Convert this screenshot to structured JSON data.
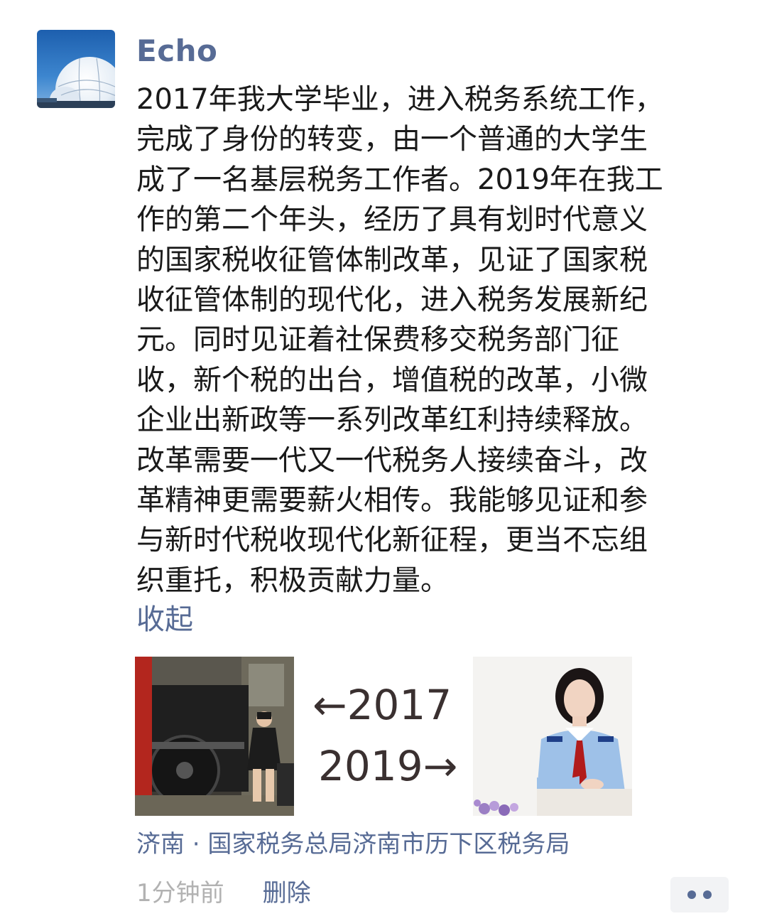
{
  "post": {
    "username": "Echo",
    "avatar_icon": "dome-photo-avatar",
    "text_lines": [
      "2017年我大学毕业，进入税务系统工作，",
      "完成了身份的转变，由一个普通的大学生",
      "成了一名基层税务工作者。2019年在我工",
      "作的第二个年头，经历了具有划时代意义",
      "的国家税收征管体制改革，见证了国家税",
      "收征管体制的现代化，进入税务发展新纪",
      "元。同时见证着社保费移交税务部门征",
      "收，新个税的出台，增值税的改革，小微",
      "企业出新政等一系列改革红利持续释放。",
      "改革需要一代又一代税务人接续奋斗，改",
      "革精神更需要薪火相传。我能够见证和参",
      "与新时代税收现代化新征程，更当不忘组",
      "织重托，积极贡献力量。"
    ],
    "collapse_label": "收起",
    "images": {
      "left_icon": "graduation-photo",
      "middle_top": "←2017",
      "middle_bottom": "2019→",
      "right_icon": "tax-uniform-photo"
    },
    "location": "济南 · 国家税务总局济南市历下区税务局",
    "timestamp": "1分钟前",
    "delete_label": "删除",
    "more_icon": "more-dots-icon"
  },
  "colors": {
    "link": "#576b95",
    "text": "#1a1a1a",
    "meta": "#b2b2b2",
    "more_bg": "#f2f3f5"
  }
}
